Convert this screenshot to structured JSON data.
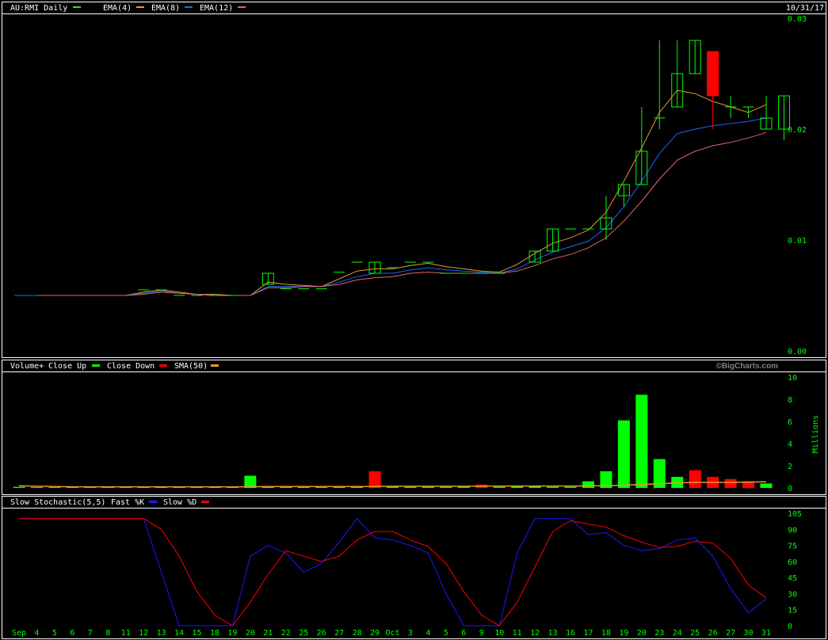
{
  "colors": {
    "background": "#000000",
    "border": "#ffffff",
    "axis_text": "#00ff00",
    "up": "#00ff00",
    "down": "#ff0000",
    "ema4": "#00ff00",
    "ema8": "#e69a2e",
    "ema12": "#1a66ff",
    "ema_last": "#e06666",
    "sma50": "#e69a2e",
    "stoch_k": "#1a1aff",
    "stoch_d": "#ff0000"
  },
  "price_panel": {
    "symbol": "AU:RMI Daily",
    "date": "10/31/17",
    "legend": [
      "EMA(4)",
      "EMA(8)",
      "EMA(12)"
    ],
    "legend_colors": [
      "#00ff00",
      "#e69a2e",
      "#1a66ff",
      "#e06666"
    ]
  },
  "volume_panel": {
    "title": "Volume+",
    "legend": [
      "Close Up",
      "Close Down",
      "SMA(50)"
    ],
    "legend_colors": [
      "#00ff00",
      "#ff0000",
      "#e69a2e"
    ],
    "units": "Millions",
    "watermark": "©BigCharts.com"
  },
  "stoch_panel": {
    "title": "Slow Stochastic(5,5)",
    "legend": [
      "Fast %K",
      "Slow %D"
    ],
    "legend_colors": [
      "#1a1aff",
      "#ff0000"
    ]
  },
  "chart_data": [
    {
      "type": "candlestick",
      "title": "AU:RMI Daily",
      "ylim": [
        0,
        0.03
      ],
      "y_ticks": [
        "0.00",
        "0.01",
        "0.02",
        "0.03"
      ],
      "x_labels": [
        "Sep",
        "4",
        "5",
        "6",
        "7",
        "8",
        "11",
        "12",
        "13",
        "14",
        "15",
        "18",
        "19",
        "20",
        "21",
        "22",
        "25",
        "26",
        "27",
        "28",
        "29",
        "Oct",
        "3",
        "4",
        "5",
        "6",
        "9",
        "10",
        "11",
        "12",
        "13",
        "16",
        "17",
        "18",
        "19",
        "20",
        "23",
        "24",
        "25",
        "26",
        "27",
        "30",
        "31"
      ],
      "candles": [
        null,
        null,
        null,
        null,
        null,
        null,
        {
          "o": 0.0055,
          "h": 0.0055,
          "l": 0.0055,
          "c": 0.0055
        },
        {
          "o": 0.0055,
          "h": 0.0055,
          "l": 0.0055,
          "c": 0.0055
        },
        {
          "o": 0.005,
          "h": 0.005,
          "l": 0.005,
          "c": 0.005
        },
        {
          "o": 0.005,
          "h": 0.005,
          "l": 0.005,
          "c": 0.005
        },
        {
          "o": 0.005,
          "h": 0.005,
          "l": 0.005,
          "c": 0.005
        },
        {
          "o": 0.005,
          "h": 0.005,
          "l": 0.005,
          "c": 0.005
        },
        null,
        {
          "o": 0.006,
          "h": 0.007,
          "l": 0.006,
          "c": 0.007
        },
        {
          "o": 0.0056,
          "h": 0.0056,
          "l": 0.0056,
          "c": 0.0056
        },
        {
          "o": 0.0056,
          "h": 0.0056,
          "l": 0.0056,
          "c": 0.0056
        },
        {
          "o": 0.0056,
          "h": 0.0056,
          "l": 0.0056,
          "c": 0.0056
        },
        {
          "o": 0.0071,
          "h": 0.0071,
          "l": 0.0071,
          "c": 0.0071
        },
        {
          "o": 0.008,
          "h": 0.008,
          "l": 0.008,
          "c": 0.008
        },
        {
          "o": 0.007,
          "h": 0.008,
          "l": 0.007,
          "c": 0.008
        },
        {
          "o": 0.0075,
          "h": 0.0075,
          "l": 0.0075,
          "c": 0.0075
        },
        {
          "o": 0.008,
          "h": 0.008,
          "l": 0.008,
          "c": 0.008
        },
        {
          "o": 0.008,
          "h": 0.008,
          "l": 0.008,
          "c": 0.008
        },
        {
          "o": 0.007,
          "h": 0.007,
          "l": 0.007,
          "c": 0.007
        },
        {
          "o": 0.007,
          "h": 0.007,
          "l": 0.007,
          "c": 0.007
        },
        {
          "o": 0.007,
          "h": 0.007,
          "l": 0.007,
          "c": 0.007
        },
        {
          "o": 0.007,
          "h": 0.007,
          "l": 0.007,
          "c": 0.007
        },
        null,
        {
          "o": 0.008,
          "h": 0.009,
          "l": 0.008,
          "c": 0.009
        },
        {
          "o": 0.009,
          "h": 0.011,
          "l": 0.009,
          "c": 0.011
        },
        {
          "o": 0.011,
          "h": 0.011,
          "l": 0.011,
          "c": 0.011
        },
        {
          "o": 0.011,
          "h": 0.011,
          "l": 0.011,
          "c": 0.011
        },
        {
          "o": 0.011,
          "h": 0.014,
          "l": 0.01,
          "c": 0.012
        },
        {
          "o": 0.014,
          "h": 0.015,
          "l": 0.013,
          "c": 0.015
        },
        {
          "o": 0.015,
          "h": 0.022,
          "l": 0.015,
          "c": 0.018
        },
        {
          "o": 0.021,
          "h": 0.028,
          "l": 0.02,
          "c": 0.021
        },
        {
          "o": 0.022,
          "h": 0.028,
          "l": 0.022,
          "c": 0.025
        },
        {
          "o": 0.025,
          "h": 0.028,
          "l": 0.025,
          "c": 0.028
        },
        {
          "o": 0.027,
          "h": 0.027,
          "l": 0.02,
          "c": 0.023
        },
        {
          "o": 0.022,
          "h": 0.023,
          "l": 0.021,
          "c": 0.022
        },
        {
          "o": 0.022,
          "h": 0.022,
          "l": 0.021,
          "c": 0.022
        },
        {
          "o": 0.02,
          "h": 0.023,
          "l": 0.02,
          "c": 0.021
        },
        {
          "o": 0.02,
          "h": 0.023,
          "l": 0.019,
          "c": 0.023
        }
      ],
      "series": [
        {
          "name": "EMA(4)",
          "values": [
            0.005,
            0.005,
            0.005,
            0.005,
            0.005,
            0.005,
            0.0053,
            0.0055,
            0.0053,
            0.0051,
            0.0051,
            0.005,
            0.005,
            0.0062,
            0.006,
            0.0059,
            0.0058,
            0.0065,
            0.0072,
            0.0074,
            0.0074,
            0.0077,
            0.0079,
            0.0076,
            0.0074,
            0.0072,
            0.0071,
            0.0078,
            0.0088,
            0.0097,
            0.0102,
            0.0109,
            0.0125,
            0.0153,
            0.0183,
            0.0215,
            0.0235,
            0.0232,
            0.0225,
            0.022,
            0.0215,
            0.0222
          ]
        },
        {
          "name": "EMA(8)",
          "values": [
            0.005,
            0.005,
            0.005,
            0.005,
            0.005,
            0.005,
            0.0052,
            0.0054,
            0.0052,
            0.0051,
            0.005,
            0.005,
            0.005,
            0.0058,
            0.0058,
            0.0058,
            0.0058,
            0.0062,
            0.0067,
            0.007,
            0.007,
            0.0073,
            0.0075,
            0.0073,
            0.0072,
            0.0071,
            0.007,
            0.0074,
            0.0082,
            0.0089,
            0.0094,
            0.0099,
            0.0111,
            0.013,
            0.0153,
            0.0178,
            0.0196,
            0.02,
            0.0203,
            0.0205,
            0.0207,
            0.021
          ]
        },
        {
          "name": "EMA(12)",
          "values": [
            0.005,
            0.005,
            0.005,
            0.005,
            0.005,
            0.005,
            0.0051,
            0.0053,
            0.0052,
            0.0051,
            0.005,
            0.005,
            0.005,
            0.0057,
            0.0057,
            0.0058,
            0.0058,
            0.006,
            0.0064,
            0.0066,
            0.0067,
            0.007,
            0.0071,
            0.007,
            0.007,
            0.007,
            0.007,
            0.0072,
            0.0077,
            0.0083,
            0.0087,
            0.0093,
            0.0102,
            0.0117,
            0.0135,
            0.0155,
            0.0172,
            0.018,
            0.0185,
            0.0188,
            0.0192,
            0.0197
          ]
        }
      ]
    },
    {
      "type": "bar",
      "title": "Volume+",
      "ylim": [
        0,
        10
      ],
      "y_ticks": [
        "0",
        "2",
        "4",
        "6",
        "8",
        "10"
      ],
      "ylabel": "Millions",
      "values": [
        0.1,
        0.05,
        0.05,
        0.05,
        0.05,
        0.05,
        0.05,
        0.05,
        0.05,
        0.05,
        0.05,
        0.05,
        0.05,
        1.1,
        0.05,
        0.05,
        0.05,
        0.05,
        0.05,
        0.05,
        1.5,
        0.1,
        0.1,
        0.1,
        0.1,
        0.1,
        0.3,
        0.1,
        0.15,
        0.15,
        0.1,
        0.1,
        0.6,
        1.5,
        6.1,
        8.4,
        2.6,
        1.0,
        1.6,
        1.0,
        0.8,
        0.6,
        0.4
      ],
      "directions": [
        "up",
        "up",
        "up",
        "up",
        "up",
        "up",
        "up",
        "up",
        "up",
        "up",
        "up",
        "up",
        "up",
        "up",
        "up",
        "up",
        "up",
        "up",
        "up",
        "up",
        "down",
        "up",
        "up",
        "up",
        "up",
        "up",
        "down",
        "up",
        "up",
        "up",
        "up",
        "up",
        "up",
        "up",
        "up",
        "up",
        "up",
        "up",
        "down",
        "down",
        "down",
        "down",
        "up"
      ],
      "series": [
        {
          "name": "SMA(50)",
          "values": [
            0.2,
            0.15,
            0.12,
            0.1,
            0.1,
            0.1,
            0.1,
            0.1,
            0.1,
            0.1,
            0.1,
            0.1,
            0.1,
            0.1,
            0.12,
            0.12,
            0.12,
            0.12,
            0.12,
            0.12,
            0.13,
            0.15,
            0.15,
            0.15,
            0.15,
            0.15,
            0.16,
            0.17,
            0.17,
            0.17,
            0.17,
            0.17,
            0.18,
            0.2,
            0.25,
            0.3,
            0.38,
            0.45,
            0.5,
            0.5,
            0.5,
            0.52,
            0.55
          ]
        }
      ]
    },
    {
      "type": "line",
      "title": "Slow Stochastic(5,5)",
      "ylim": [
        0,
        105
      ],
      "y_ticks": [
        "0",
        "15",
        "30",
        "45",
        "60",
        "75",
        "90",
        "105"
      ],
      "series": [
        {
          "name": "Fast %K",
          "values": [
            100,
            100,
            100,
            100,
            100,
            100,
            100,
            100,
            50,
            0,
            0,
            0,
            0,
            65,
            75,
            68,
            50,
            58,
            78,
            100,
            82,
            80,
            75,
            68,
            30,
            0,
            0,
            0,
            68,
            100,
            100,
            100,
            85,
            87,
            75,
            70,
            72,
            80,
            82,
            65,
            35,
            12,
            25
          ]
        },
        {
          "name": "Slow %D",
          "values": [
            100,
            100,
            100,
            100,
            100,
            100,
            100,
            100,
            90,
            65,
            32,
            10,
            0,
            22,
            48,
            70,
            65,
            60,
            65,
            80,
            88,
            88,
            80,
            74,
            58,
            32,
            10,
            0,
            22,
            55,
            88,
            98,
            95,
            92,
            84,
            78,
            73,
            74,
            79,
            77,
            63,
            38,
            26
          ]
        }
      ]
    }
  ]
}
